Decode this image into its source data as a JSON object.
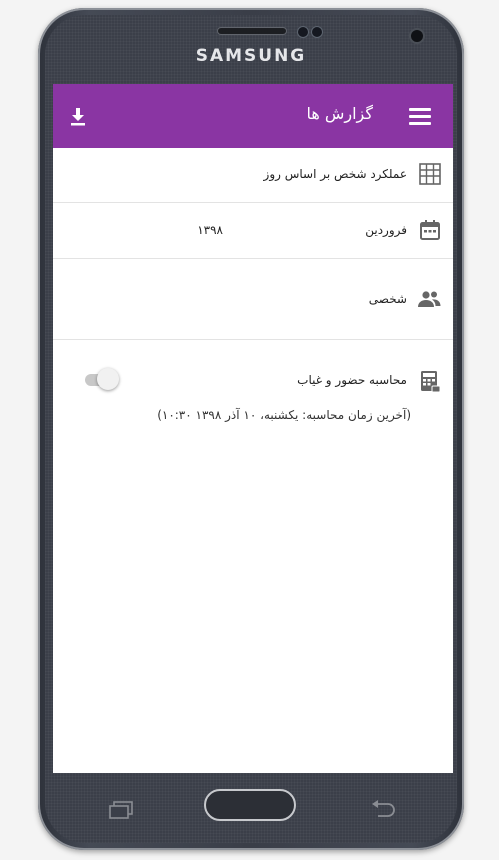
{
  "device": {
    "brand": "SAMSUNG"
  },
  "appbar": {
    "title": "گزارش ها",
    "menu_icon": "hamburger-menu-icon",
    "download_icon": "download-icon",
    "color": "#8a35a3"
  },
  "report": {
    "type_label": "عملکرد شخص بر اساس روز",
    "type_icon": "table-grid-icon",
    "month_label": "فروردین",
    "year_value": "۱۳۹۸",
    "month_icon": "calendar-icon",
    "scope_label": "شخصی",
    "scope_icon": "people-icon"
  },
  "attendance": {
    "label": "محاسبه حضور و غیاب",
    "icon": "calculator-icon",
    "toggle_state": false,
    "last_calc": "(آخرین زمان محاسبه: یکشنبه، ۱۰ آذر ۱۳۹۸    ۱۰:۳۰)"
  },
  "nav": {
    "recent_icon": "recent-apps-icon",
    "home_icon": "home-button",
    "back_icon": "back-icon"
  }
}
